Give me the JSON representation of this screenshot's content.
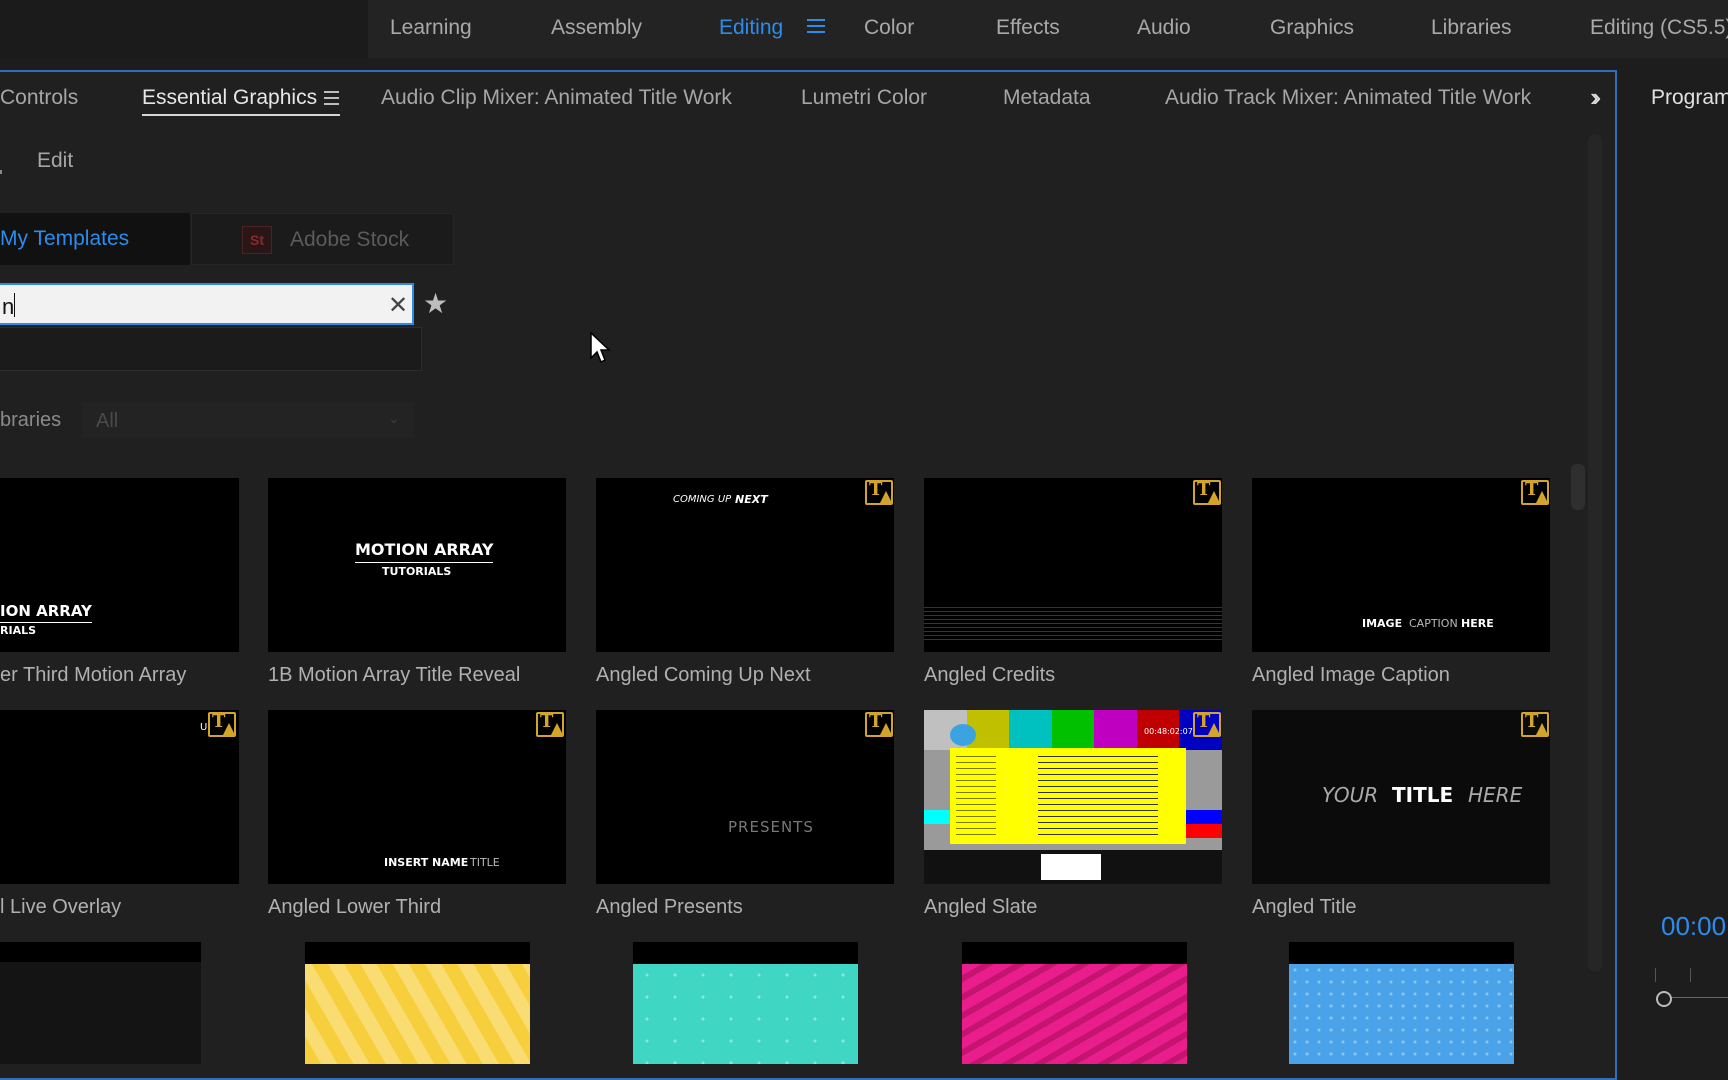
{
  "workspaces": {
    "items": [
      "Learning",
      "Assembly",
      "Editing",
      "Color",
      "Effects",
      "Audio",
      "Graphics",
      "Libraries",
      "Editing (CS5.5)"
    ],
    "active": "Editing"
  },
  "panel_tabs": {
    "controls": "Controls",
    "essential_graphics": "Essential Graphics",
    "audio_clip_mixer": "Audio Clip Mixer: Animated Title Work",
    "lumetri_color": "Lumetri Color",
    "metadata": "Metadata",
    "audio_track_mixer": "Audio Track Mixer: Animated Title Work"
  },
  "sub_tabs": {
    "edit": "Edit"
  },
  "source_buttons": {
    "my_templates": "My Templates",
    "adobe_stock": "Adobe Stock",
    "stock_badge": "St"
  },
  "search": {
    "value": "n"
  },
  "libraries": {
    "label": "braries",
    "selected": "All"
  },
  "templates": [
    {
      "label": "er Third Motion Array",
      "line1": "ION ARRAY",
      "line2": "RIALS"
    },
    {
      "label": "1B Motion Array Title Reveal",
      "line1": "MOTION ARRAY",
      "line2": "TUTORIALS"
    },
    {
      "label": "Angled Coming Up Next",
      "text_a": "COMING UP",
      "text_b": "NEXT"
    },
    {
      "label": "Angled Credits"
    },
    {
      "label": "Angled Image Caption",
      "text_a": "IMAGE",
      "text_b": "CAPTION",
      "text_c": "HERE"
    },
    {
      "label": "l Live Overlay",
      "text_a": "U"
    },
    {
      "label": "Angled Lower Third",
      "text_a": "INSERT NAME",
      "text_b": "TITLE"
    },
    {
      "label": "Angled Presents",
      "text_a": "PRESENTS"
    },
    {
      "label": "Angled Slate",
      "timecode": "00:48:02:07"
    },
    {
      "label": "Angled Title",
      "text_a": "YOUR",
      "text_b": "TITLE",
      "text_c": "HERE"
    }
  ],
  "pattern_colors": [
    "#141414",
    "#f7cf3c",
    "#40d6c4",
    "#e91e8c",
    "#4aa3e8"
  ],
  "program_monitor": {
    "title": "Program",
    "timecode": "00:00"
  },
  "colors": {
    "accent": "#2d8ceb",
    "badge": "#d2a52a"
  }
}
